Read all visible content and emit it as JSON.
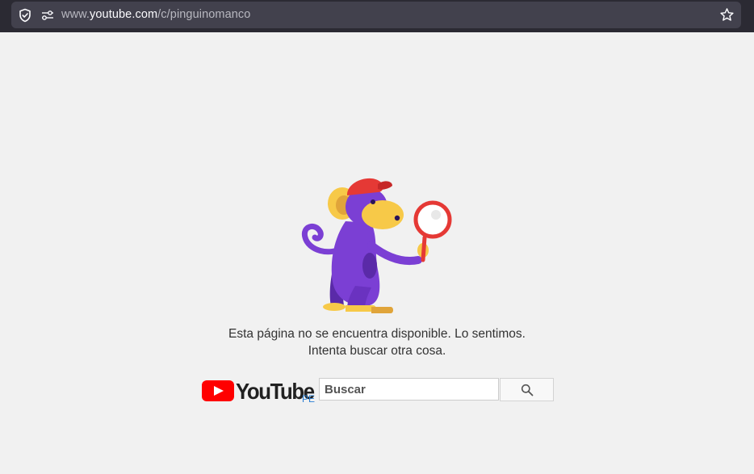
{
  "browser": {
    "url_prefix": "www.",
    "url_host": "youtube.com",
    "url_path": "/c/pinguinomanco",
    "icons": [
      "shield-icon",
      "permissions-icon",
      "star-icon"
    ]
  },
  "error": {
    "line1": "Esta página no se encuentra disponible. Lo sentimos.",
    "line2": "Intenta buscar otra cosa.",
    "illustration": "monkey-magnifier-illustration"
  },
  "footer": {
    "logo_text": "YouTube",
    "country_code": "PE",
    "search_placeholder": "Buscar",
    "search_button_icon": "search-icon"
  },
  "colors": {
    "youtube_red": "#ff0000",
    "background": "#f1f1f1",
    "monkey_purple": "#7b3fd4",
    "monkey_yellow": "#f7c948",
    "country_blue": "#2a7fd4"
  }
}
